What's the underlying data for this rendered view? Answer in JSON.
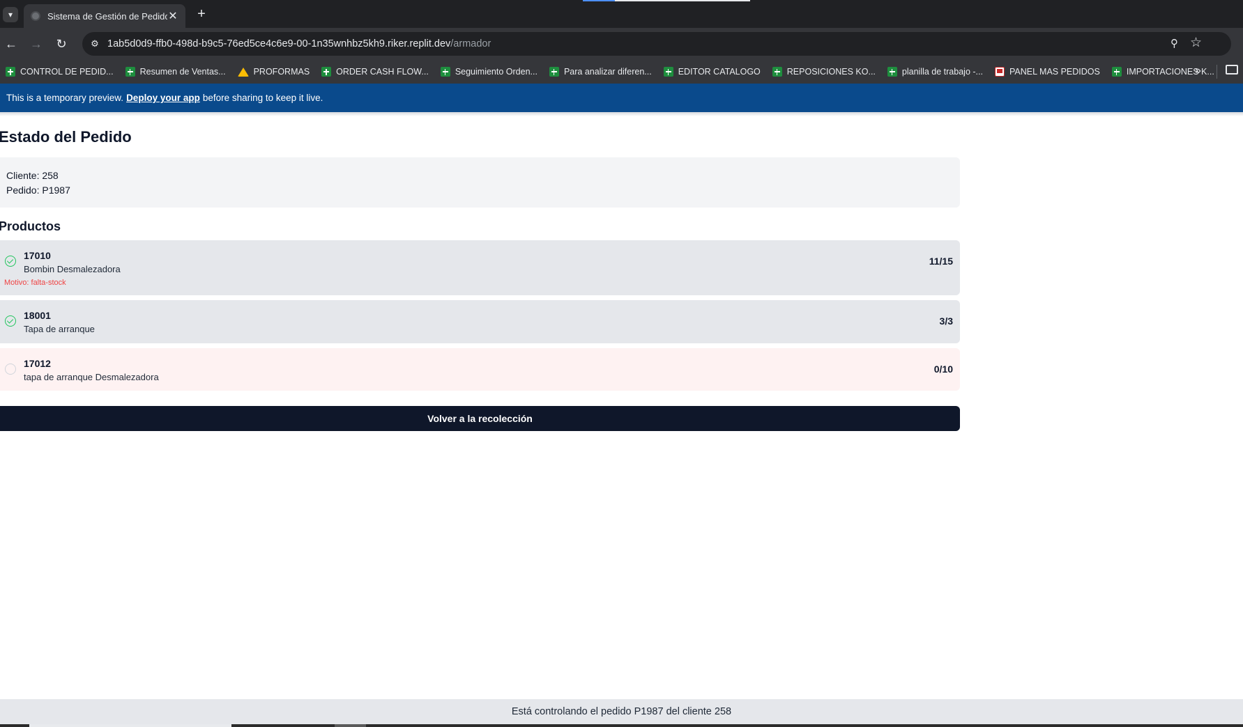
{
  "browser": {
    "tab_title": "Sistema de Gestión de Pedidos",
    "url_host": "1ab5d0d9-ffb0-498d-b9c5-76ed5ce4c6e9-00-1n35wnhbz5kh9.riker.replit.dev",
    "url_path": "/armador",
    "bookmarks": [
      {
        "label": "CONTROL DE PEDID...",
        "icon": "sheets-icon"
      },
      {
        "label": "Resumen de Ventas...",
        "icon": "sheets-icon"
      },
      {
        "label": "PROFORMAS",
        "icon": "drive-icon"
      },
      {
        "label": "ORDER CASH FLOW...",
        "icon": "sheets-icon"
      },
      {
        "label": "Seguimiento Orden...",
        "icon": "sheets-icon"
      },
      {
        "label": "Para analizar diferen...",
        "icon": "sheets-icon"
      },
      {
        "label": "EDITOR CATALOGO",
        "icon": "sheets-icon"
      },
      {
        "label": "REPOSICIONES KO...",
        "icon": "sheets-icon"
      },
      {
        "label": "planilla de trabajo -...",
        "icon": "sheets-icon"
      },
      {
        "label": "PANEL MAS PEDIDOS",
        "icon": "panel-icon"
      },
      {
        "label": "IMPORTACIONES K...",
        "icon": "sheets-icon"
      }
    ]
  },
  "banner": {
    "prefix": "This is a temporary preview.",
    "link": "Deploy your app",
    "suffix": "before sharing to keep it live."
  },
  "page": {
    "title": "Estado del Pedido",
    "cliente": "Cliente: 258",
    "pedido": "Pedido: P1987",
    "products_title": "Productos",
    "products": [
      {
        "code": "17010",
        "name": "Bombin Desmalezadora",
        "qty": "11/15",
        "reason": "Motivo: falta-stock",
        "status": "complete"
      },
      {
        "code": "18001",
        "name": "Tapa de arranque",
        "qty": "3/3",
        "status": "complete"
      },
      {
        "code": "17012",
        "name": "tapa de arranque Desmalezadora",
        "qty": "0/10",
        "status": "pending"
      }
    ],
    "back_button": "Volver a la recolección",
    "footer": "Está controlando el pedido P1987 del cliente 258"
  },
  "colors": {
    "banner": "#0a4a8c",
    "button": "#0f172a",
    "success": "#22c55e",
    "error": "#ef4444",
    "pending_row": "#fef2f2"
  }
}
